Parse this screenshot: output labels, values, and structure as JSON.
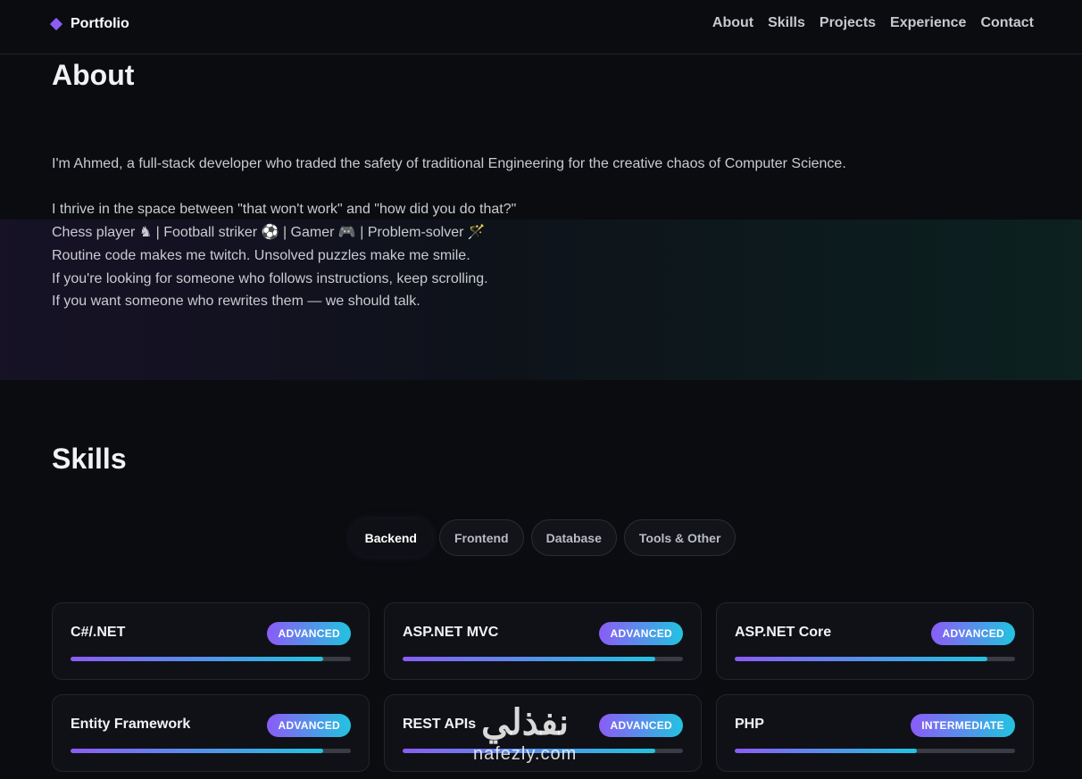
{
  "nav": {
    "brand": "Portfolio",
    "brand_icon": "diamond-icon",
    "links": [
      "About",
      "Skills",
      "Projects",
      "Experience",
      "Contact"
    ]
  },
  "about": {
    "title": "About",
    "lines": [
      "I'm Ahmed, a full-stack developer who traded the safety of traditional Engineering for the creative chaos of Computer Science.",
      "I thrive in the space between \"that won't work\" and \"how did you do that?\"",
      "Chess player ♞ | Football striker ⚽ | Gamer 🎮 | Problem-solver 🪄",
      "Routine code makes me twitch. Unsolved puzzles make me smile.",
      "If you're looking for someone who follows instructions, keep scrolling.",
      "If you want someone who rewrites them — we should talk."
    ]
  },
  "skills": {
    "title": "Skills",
    "tabs": [
      "Backend",
      "Frontend",
      "Database",
      "Tools & Other"
    ],
    "active_tab": "Backend",
    "cards": [
      {
        "name": "C#/.NET",
        "level": "ADVANCED",
        "progress": 0.9
      },
      {
        "name": "ASP.NET MVC",
        "level": "ADVANCED",
        "progress": 0.9
      },
      {
        "name": "ASP.NET Core",
        "level": "ADVANCED",
        "progress": 0.9
      },
      {
        "name": "Entity Framework",
        "level": "ADVANCED",
        "progress": 0.9
      },
      {
        "name": "REST APIs",
        "level": "ADVANCED",
        "progress": 0.9
      },
      {
        "name": "PHP",
        "level": "INTERMEDIATE",
        "progress": 0.65
      }
    ]
  },
  "watermark": {
    "arabic": "نفذلي",
    "latin": "nafezly.com"
  },
  "colors": {
    "accent_start": "#8b5cf6",
    "accent_end": "#22c3e0",
    "background": "#0b0c10"
  }
}
